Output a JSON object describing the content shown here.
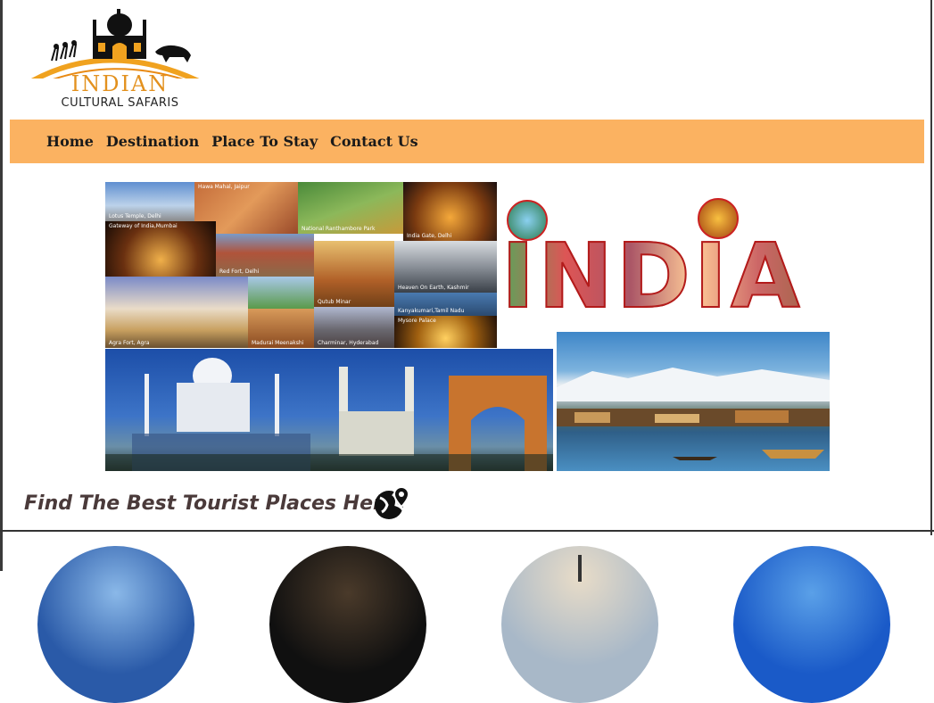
{
  "logo": {
    "title": "INDIAN",
    "subtitle": "CULTURAL SAFARIS",
    "icon": "taj-mahal-safari-logo"
  },
  "nav": {
    "items": [
      "Home",
      "Destination",
      "Place To Stay",
      "Contact Us"
    ]
  },
  "hero": {
    "word": "INDIA",
    "captions": [
      "Lotus Temple, Delhi",
      "Hawa Mahal, Jaipur",
      "National Ranthambore Park",
      "India Gate, Delhi",
      "Gateway of India,Mumbai",
      "Red Fort, Delhi",
      "Qutub Minar",
      "Heaven On Earth, Kashmir",
      "Kanyakumari,Tamil Nadu",
      "Agra Fort, Agra",
      "Madurai Meenakshi",
      "Charminar, Hyderabad",
      "Mysore Palace"
    ]
  },
  "main": {
    "heading": "Find The Best Tourist Places Here",
    "heading_icon": "globe-location-icon"
  },
  "colors": {
    "nav_background": "#fbb261",
    "logo_orange": "#e3911e",
    "heading_text": "#4a3a3a"
  }
}
